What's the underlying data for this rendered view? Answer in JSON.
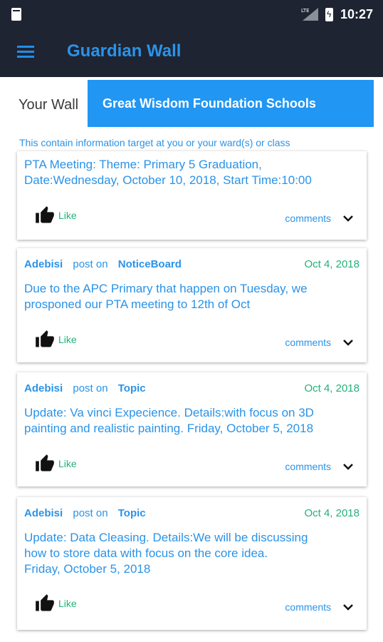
{
  "status_bar": {
    "time": "10:27"
  },
  "app_bar": {
    "title": "Guardian Wall"
  },
  "tabs": {
    "your_wall": "Your Wall",
    "school": "Great Wisdom Foundation Schools"
  },
  "info_text": "This contain information target at you or your ward(s) or class",
  "posts": [
    {
      "body_lines": [
        "PTA Meeting: Theme: Primary 5 Graduation,",
        "Date:Wednesday, October 10, 2018, Start Time:10:00"
      ],
      "like": "Like",
      "comments": "comments"
    },
    {
      "author": "Adebisi",
      "post_on": "post on",
      "board": "NoticeBoard",
      "date": "Oct 4, 2018",
      "body_lines": [
        "Due to the APC Primary that happen on Tuesday, we",
        "prosponed our PTA meeting to 12th of Oct"
      ],
      "like": "Like",
      "comments": "comments"
    },
    {
      "author": "Adebisi",
      "post_on": "post on",
      "board": "Topic",
      "date": "Oct 4, 2018",
      "body_lines": [
        "Update: Va vinci Expecience. Details:with focus on 3D",
        "painting and realistic painting. Friday, October 5, 2018"
      ],
      "like": "Like",
      "comments": "comments"
    },
    {
      "author": "Adebisi",
      "post_on": "post on",
      "board": "Topic",
      "date": "Oct 4, 2018",
      "body_lines": [
        "Update: Data Cleasing. Details:We will be discussing",
        "how to store data with focus on the core idea.",
        "Friday, October 5, 2018"
      ],
      "like": "Like",
      "comments": "comments"
    }
  ]
}
